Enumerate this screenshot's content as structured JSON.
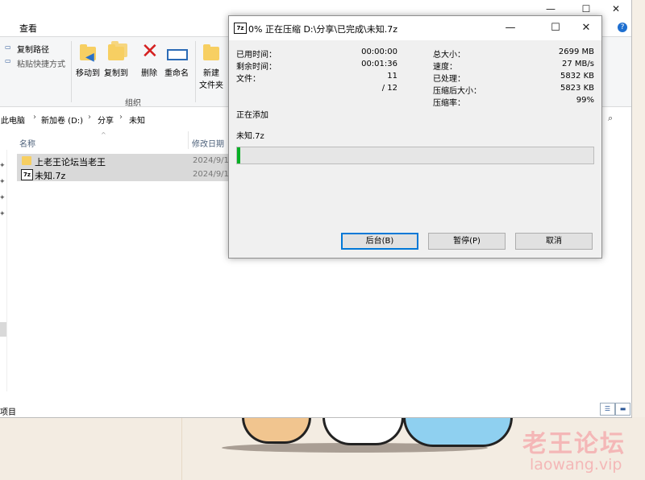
{
  "explorer": {
    "menu_tab": "查看",
    "window_controls": [
      "—",
      "☐",
      "✕"
    ],
    "help_icon": "?",
    "ribbon": {
      "copy_path": "复制路径",
      "paste_shortcut": "粘贴快捷方式",
      "move_to": "移动到",
      "copy_to": "复制到",
      "delete": "删除",
      "rename": "重命名",
      "new_folder_line1": "新建",
      "new_folder_line2": "文件夹",
      "group_organize": "组织"
    },
    "breadcrumb": [
      "此电脑",
      "新加卷 (D:)",
      "分享",
      "未知"
    ],
    "columns": {
      "name": "名称",
      "modified": "修改日期"
    },
    "files": [
      {
        "name": "上老王论坛当老王",
        "date": "2024/9/1",
        "type": "folder"
      },
      {
        "name": "未知.7z",
        "date": "2024/9/16",
        "type": "7z"
      }
    ],
    "status": "项目"
  },
  "dialog": {
    "app_icon": "7z",
    "title": "0% 正在压缩 D:\\分享\\已完成\\未知.7z",
    "controls": [
      "—",
      "☐",
      "✕"
    ],
    "left": {
      "elapsed_label": "已用时间：",
      "elapsed_value": "00:00:00",
      "remaining_label": "剩余时间：",
      "remaining_value": "00:01:36",
      "files_label": "文件：",
      "files_value": "11",
      "files_total": "/ 12"
    },
    "right": {
      "total_label": "总大小：",
      "total_value": "2699 MB",
      "speed_label": "速度：",
      "speed_value": "27 MB/s",
      "processed_label": "已处理：",
      "processed_value": "5832 KB",
      "compressed_label": "压缩后大小：",
      "compressed_value": "5823 KB",
      "ratio_label": "压缩率：",
      "ratio_value": "99%"
    },
    "status": "正在添加",
    "current_file": "未知.7z",
    "progress": 0.01,
    "buttons": {
      "background": "后台(B)",
      "pause": "暂停(P)",
      "cancel": "取消"
    }
  },
  "wallpaper": {
    "watermark_cn": "老王论坛",
    "watermark_en": "laowang.vip"
  },
  "colors": {
    "progress": "#06b025",
    "selection": "#d9d9d9",
    "accent": "#0078d7"
  }
}
